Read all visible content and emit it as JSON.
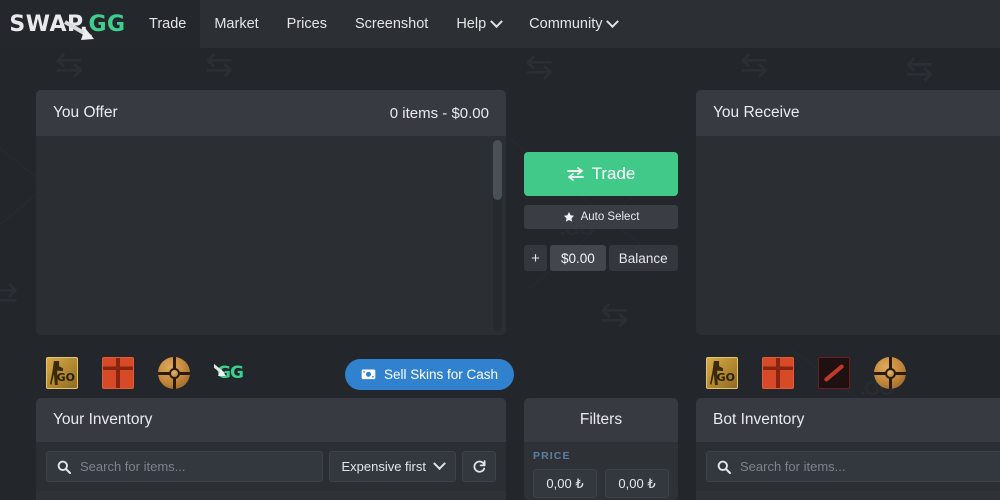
{
  "navbar": {
    "logo": {
      "part1": "SWAP.",
      "part2": "GG",
      "icon": "swap-arrow-icon"
    },
    "items": [
      {
        "label": "Trade",
        "active": true,
        "caret": false
      },
      {
        "label": "Market",
        "active": false,
        "caret": false
      },
      {
        "label": "Prices",
        "active": false,
        "caret": false
      },
      {
        "label": "Screenshot",
        "active": false,
        "caret": false
      },
      {
        "label": "Help",
        "active": false,
        "caret": true
      },
      {
        "label": "Community",
        "active": false,
        "caret": true
      }
    ]
  },
  "offer_panel": {
    "title": "You Offer",
    "meta": "0 items - $0.00"
  },
  "receive_panel": {
    "title": "You Receive"
  },
  "trade_column": {
    "trade_label": "Trade",
    "trade_icon": "swap-arrows-icon",
    "trade_color": "#41c98a",
    "auto_select_label": "Auto Select",
    "auto_select_icon": "magic-wand-icon",
    "balance_plus": "+",
    "balance_amount": "$0.00",
    "balance_label": "Balance"
  },
  "game_tabs_left": [
    {
      "name": "csgo",
      "label": "GO"
    },
    {
      "name": "rust",
      "label": ""
    },
    {
      "name": "ball",
      "label": ""
    },
    {
      "name": "swapgg",
      "label": "GG"
    }
  ],
  "game_tabs_right": [
    {
      "name": "csgo",
      "label": "GO"
    },
    {
      "name": "rust",
      "label": ""
    },
    {
      "name": "dota",
      "label": ""
    },
    {
      "name": "ball",
      "label": ""
    }
  ],
  "sell_button": {
    "label": "Sell Skins for Cash",
    "icon": "money-icon",
    "color": "#3182ce"
  },
  "your_inventory": {
    "title": "Your Inventory",
    "search_placeholder": "Search for items...",
    "search_value": "",
    "search_icon": "search-icon",
    "sort_value": "Expensive first",
    "sort_caret": "chevron-down-icon",
    "refresh_icon": "refresh-icon"
  },
  "bot_inventory": {
    "title": "Bot Inventory",
    "search_placeholder": "Search for items...",
    "search_value": "",
    "search_icon": "search-icon"
  },
  "filters": {
    "title": "Filters",
    "price_label": "PRICE",
    "price_label_color": "#5b7fa6",
    "price_min": "0,00 ₺",
    "price_max": "0,00 ₺"
  }
}
